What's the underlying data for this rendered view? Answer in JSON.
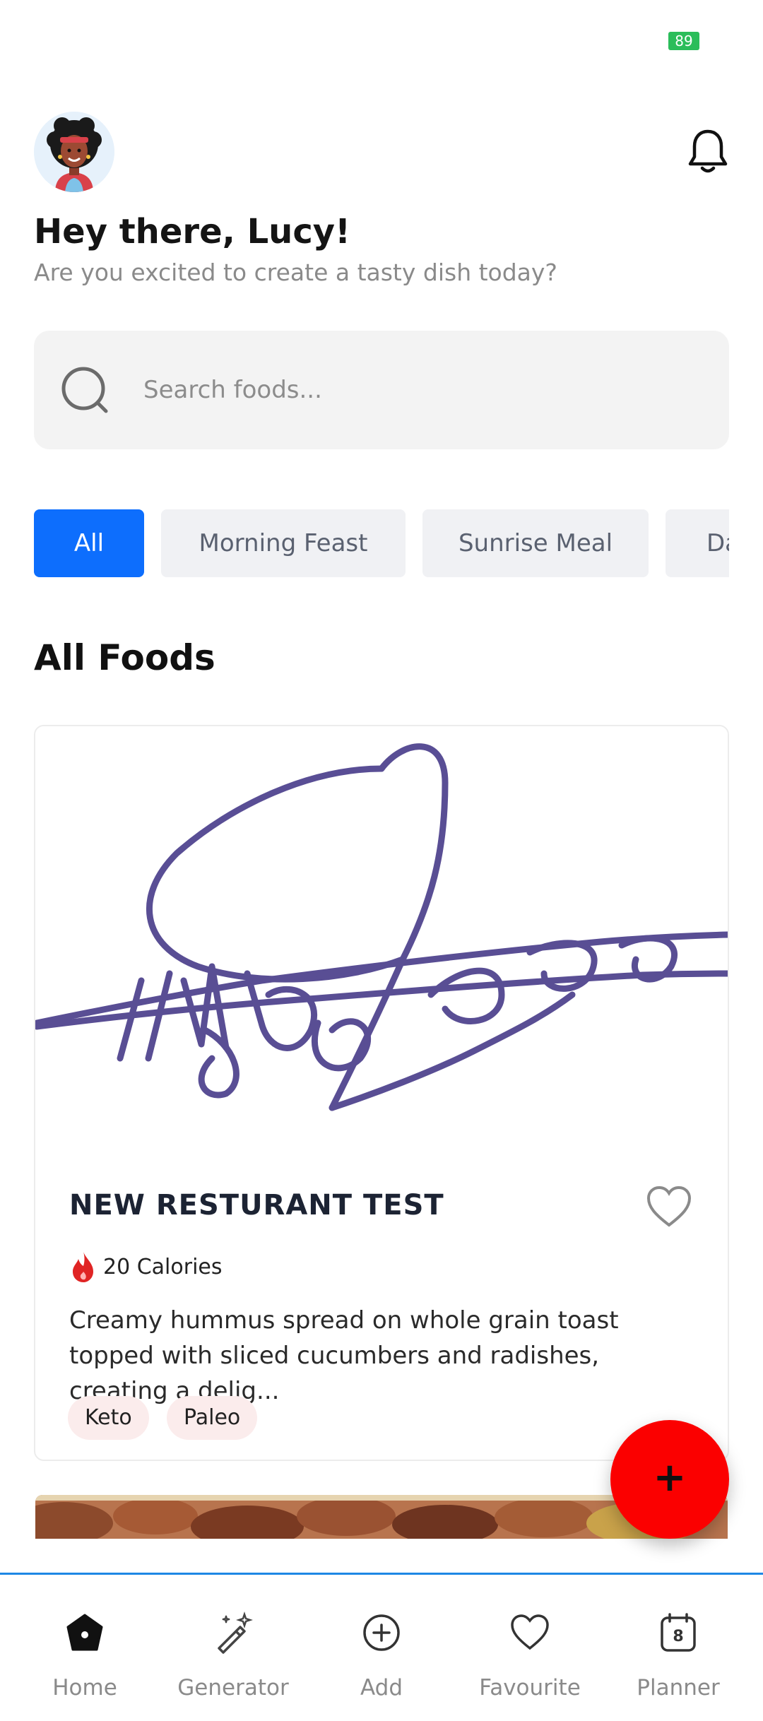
{
  "status_bar": {
    "battery": "89"
  },
  "header": {
    "greeting": "Hey there, Lucy!",
    "subtitle": "Are you excited to create a tasty dish today?"
  },
  "search": {
    "placeholder": "Search foods..."
  },
  "categories": [
    {
      "label": "All",
      "active": true
    },
    {
      "label": "Morning Feast",
      "active": false
    },
    {
      "label": "Sunrise Meal",
      "active": false
    },
    {
      "label": "Da",
      "active": false
    }
  ],
  "section_title": "All Foods",
  "food_card": {
    "title": "NEW RESTURANT TEST",
    "calories": "20 Calories",
    "description": "Creamy hummus spread on whole grain toast topped with sliced cucumbers and radishes, creating a delig...",
    "tags": [
      "Keto",
      "Paleo"
    ]
  },
  "fab": {
    "label": "+"
  },
  "bottom_nav": [
    {
      "label": "Home",
      "icon": "home-icon",
      "active": true
    },
    {
      "label": "Generator",
      "icon": "magic-wand-icon",
      "active": false
    },
    {
      "label": "Add",
      "icon": "add-circle-icon",
      "active": false
    },
    {
      "label": "Favourite",
      "icon": "heart-icon",
      "active": false
    },
    {
      "label": "Planner",
      "icon": "calendar-icon",
      "active": false,
      "badge": "8"
    }
  ],
  "colors": {
    "accent": "#0d6efd",
    "fab": "#fb0000",
    "nav_border": "#1e88e5",
    "battery": "#2bbd5a"
  }
}
